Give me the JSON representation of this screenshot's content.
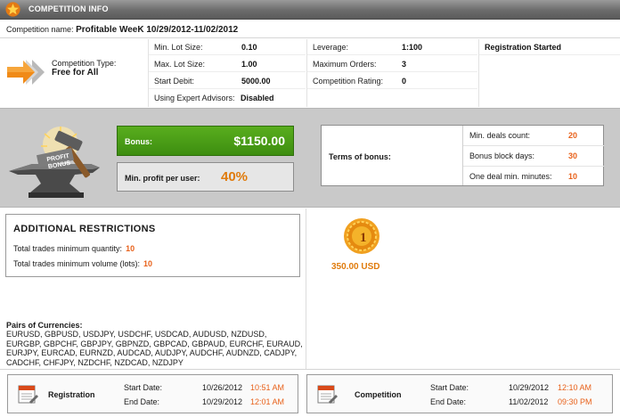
{
  "header": {
    "title": "COMPETITION INFO"
  },
  "competition": {
    "name_label": "Competition name:",
    "name": "Profitable WeeK 10/29/2012-11/02/2012"
  },
  "type": {
    "label": "Competition Type:",
    "value": "Free for All"
  },
  "params": {
    "min_lot_label": "Min. Lot Size:",
    "min_lot": "0.10",
    "max_lot_label": "Max. Lot Size:",
    "max_lot": "1.00",
    "start_debit_label": "Start Debit:",
    "start_debit": "5000.00",
    "experts_label": "Using Expert Advisors:",
    "experts": "Disabled",
    "leverage_label": "Leverage:",
    "leverage": "1:100",
    "max_orders_label": "Maximum Orders:",
    "max_orders": "3",
    "rating_label": "Competition Rating:",
    "rating": "0",
    "status": "Registration Started"
  },
  "bonus": {
    "anvil_text": "PROFIT BONUS",
    "bonus_label": "Bonus:",
    "bonus_value": "$1150.00",
    "profit_label": "Min. profit per user:",
    "profit_value": "40%",
    "terms_label": "Terms of bonus:",
    "terms": [
      {
        "label": "Min. deals count:",
        "value": "20"
      },
      {
        "label": "Bonus block days:",
        "value": "30"
      },
      {
        "label": "One deal min. minutes:",
        "value": "10"
      }
    ]
  },
  "restrictions": {
    "title": "ADDITIONAL RESTRICTIONS",
    "min_qty_label": "Total trades minimum quantity:",
    "min_qty": "10",
    "min_vol_label": "Total trades minimum volume (lots):",
    "min_vol": "10"
  },
  "prize": {
    "place": "1",
    "amount": "350.00 USD"
  },
  "pairs": {
    "label": "Pairs of Currencies:",
    "lines": [
      "EURUSD, GBPUSD, USDJPY, USDCHF, USDCAD, AUDUSD, NZDUSD,",
      "EURGBP, GBPCHF, GBPJPY, GBPNZD, GBPCAD, GBPAUD, EURCHF, EURAUD,",
      "EURJPY, EURCAD, EURNZD, AUDCAD, AUDJPY, AUDCHF, AUDNZD, CADJPY,",
      "CADCHF, CHFJPY, NZDCHF, NZDCAD, NZDJPY"
    ]
  },
  "dates": {
    "registration": {
      "title": "Registration",
      "start_label": "Start Date:",
      "start_date": "10/26/2012",
      "start_time": "10:51 AM",
      "end_label": "End Date:",
      "end_date": "10/29/2012",
      "end_time": "12:01 AM"
    },
    "competition": {
      "title": "Competition",
      "start_label": "Start Date:",
      "start_date": "10/29/2012",
      "start_time": "12:10 AM",
      "end_label": "End Date:",
      "end_date": "11/02/2012",
      "end_time": "09:30 PM"
    }
  },
  "colors": {
    "accent_orange": "#e8611a",
    "bonus_green": "#4a9c18",
    "header_gray": "#6c6c6c"
  }
}
